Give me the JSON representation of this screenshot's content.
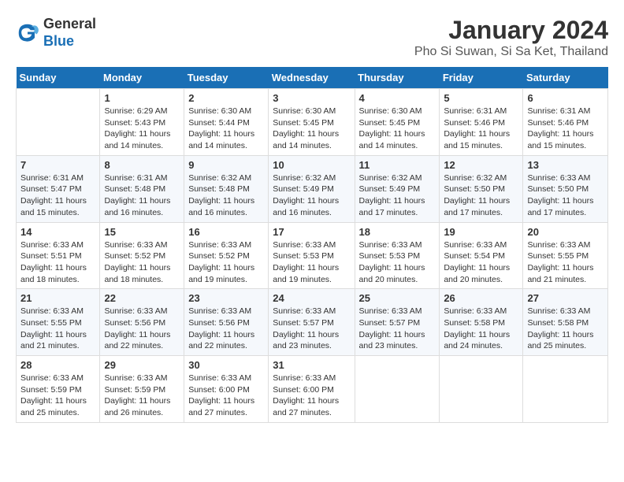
{
  "logo": {
    "line1": "General",
    "line2": "Blue"
  },
  "title": "January 2024",
  "subtitle": "Pho Si Suwan, Si Sa Ket, Thailand",
  "weekdays": [
    "Sunday",
    "Monday",
    "Tuesday",
    "Wednesday",
    "Thursday",
    "Friday",
    "Saturday"
  ],
  "weeks": [
    [
      {
        "day": "",
        "sunrise": "",
        "sunset": "",
        "daylight": ""
      },
      {
        "day": "1",
        "sunrise": "Sunrise: 6:29 AM",
        "sunset": "Sunset: 5:43 PM",
        "daylight": "Daylight: 11 hours and 14 minutes."
      },
      {
        "day": "2",
        "sunrise": "Sunrise: 6:30 AM",
        "sunset": "Sunset: 5:44 PM",
        "daylight": "Daylight: 11 hours and 14 minutes."
      },
      {
        "day": "3",
        "sunrise": "Sunrise: 6:30 AM",
        "sunset": "Sunset: 5:45 PM",
        "daylight": "Daylight: 11 hours and 14 minutes."
      },
      {
        "day": "4",
        "sunrise": "Sunrise: 6:30 AM",
        "sunset": "Sunset: 5:45 PM",
        "daylight": "Daylight: 11 hours and 14 minutes."
      },
      {
        "day": "5",
        "sunrise": "Sunrise: 6:31 AM",
        "sunset": "Sunset: 5:46 PM",
        "daylight": "Daylight: 11 hours and 15 minutes."
      },
      {
        "day": "6",
        "sunrise": "Sunrise: 6:31 AM",
        "sunset": "Sunset: 5:46 PM",
        "daylight": "Daylight: 11 hours and 15 minutes."
      }
    ],
    [
      {
        "day": "7",
        "sunrise": "Sunrise: 6:31 AM",
        "sunset": "Sunset: 5:47 PM",
        "daylight": "Daylight: 11 hours and 15 minutes."
      },
      {
        "day": "8",
        "sunrise": "Sunrise: 6:31 AM",
        "sunset": "Sunset: 5:48 PM",
        "daylight": "Daylight: 11 hours and 16 minutes."
      },
      {
        "day": "9",
        "sunrise": "Sunrise: 6:32 AM",
        "sunset": "Sunset: 5:48 PM",
        "daylight": "Daylight: 11 hours and 16 minutes."
      },
      {
        "day": "10",
        "sunrise": "Sunrise: 6:32 AM",
        "sunset": "Sunset: 5:49 PM",
        "daylight": "Daylight: 11 hours and 16 minutes."
      },
      {
        "day": "11",
        "sunrise": "Sunrise: 6:32 AM",
        "sunset": "Sunset: 5:49 PM",
        "daylight": "Daylight: 11 hours and 17 minutes."
      },
      {
        "day": "12",
        "sunrise": "Sunrise: 6:32 AM",
        "sunset": "Sunset: 5:50 PM",
        "daylight": "Daylight: 11 hours and 17 minutes."
      },
      {
        "day": "13",
        "sunrise": "Sunrise: 6:33 AM",
        "sunset": "Sunset: 5:50 PM",
        "daylight": "Daylight: 11 hours and 17 minutes."
      }
    ],
    [
      {
        "day": "14",
        "sunrise": "Sunrise: 6:33 AM",
        "sunset": "Sunset: 5:51 PM",
        "daylight": "Daylight: 11 hours and 18 minutes."
      },
      {
        "day": "15",
        "sunrise": "Sunrise: 6:33 AM",
        "sunset": "Sunset: 5:52 PM",
        "daylight": "Daylight: 11 hours and 18 minutes."
      },
      {
        "day": "16",
        "sunrise": "Sunrise: 6:33 AM",
        "sunset": "Sunset: 5:52 PM",
        "daylight": "Daylight: 11 hours and 19 minutes."
      },
      {
        "day": "17",
        "sunrise": "Sunrise: 6:33 AM",
        "sunset": "Sunset: 5:53 PM",
        "daylight": "Daylight: 11 hours and 19 minutes."
      },
      {
        "day": "18",
        "sunrise": "Sunrise: 6:33 AM",
        "sunset": "Sunset: 5:53 PM",
        "daylight": "Daylight: 11 hours and 20 minutes."
      },
      {
        "day": "19",
        "sunrise": "Sunrise: 6:33 AM",
        "sunset": "Sunset: 5:54 PM",
        "daylight": "Daylight: 11 hours and 20 minutes."
      },
      {
        "day": "20",
        "sunrise": "Sunrise: 6:33 AM",
        "sunset": "Sunset: 5:55 PM",
        "daylight": "Daylight: 11 hours and 21 minutes."
      }
    ],
    [
      {
        "day": "21",
        "sunrise": "Sunrise: 6:33 AM",
        "sunset": "Sunset: 5:55 PM",
        "daylight": "Daylight: 11 hours and 21 minutes."
      },
      {
        "day": "22",
        "sunrise": "Sunrise: 6:33 AM",
        "sunset": "Sunset: 5:56 PM",
        "daylight": "Daylight: 11 hours and 22 minutes."
      },
      {
        "day": "23",
        "sunrise": "Sunrise: 6:33 AM",
        "sunset": "Sunset: 5:56 PM",
        "daylight": "Daylight: 11 hours and 22 minutes."
      },
      {
        "day": "24",
        "sunrise": "Sunrise: 6:33 AM",
        "sunset": "Sunset: 5:57 PM",
        "daylight": "Daylight: 11 hours and 23 minutes."
      },
      {
        "day": "25",
        "sunrise": "Sunrise: 6:33 AM",
        "sunset": "Sunset: 5:57 PM",
        "daylight": "Daylight: 11 hours and 23 minutes."
      },
      {
        "day": "26",
        "sunrise": "Sunrise: 6:33 AM",
        "sunset": "Sunset: 5:58 PM",
        "daylight": "Daylight: 11 hours and 24 minutes."
      },
      {
        "day": "27",
        "sunrise": "Sunrise: 6:33 AM",
        "sunset": "Sunset: 5:58 PM",
        "daylight": "Daylight: 11 hours and 25 minutes."
      }
    ],
    [
      {
        "day": "28",
        "sunrise": "Sunrise: 6:33 AM",
        "sunset": "Sunset: 5:59 PM",
        "daylight": "Daylight: 11 hours and 25 minutes."
      },
      {
        "day": "29",
        "sunrise": "Sunrise: 6:33 AM",
        "sunset": "Sunset: 5:59 PM",
        "daylight": "Daylight: 11 hours and 26 minutes."
      },
      {
        "day": "30",
        "sunrise": "Sunrise: 6:33 AM",
        "sunset": "Sunset: 6:00 PM",
        "daylight": "Daylight: 11 hours and 27 minutes."
      },
      {
        "day": "31",
        "sunrise": "Sunrise: 6:33 AM",
        "sunset": "Sunset: 6:00 PM",
        "daylight": "Daylight: 11 hours and 27 minutes."
      },
      {
        "day": "",
        "sunrise": "",
        "sunset": "",
        "daylight": ""
      },
      {
        "day": "",
        "sunrise": "",
        "sunset": "",
        "daylight": ""
      },
      {
        "day": "",
        "sunrise": "",
        "sunset": "",
        "daylight": ""
      }
    ]
  ]
}
